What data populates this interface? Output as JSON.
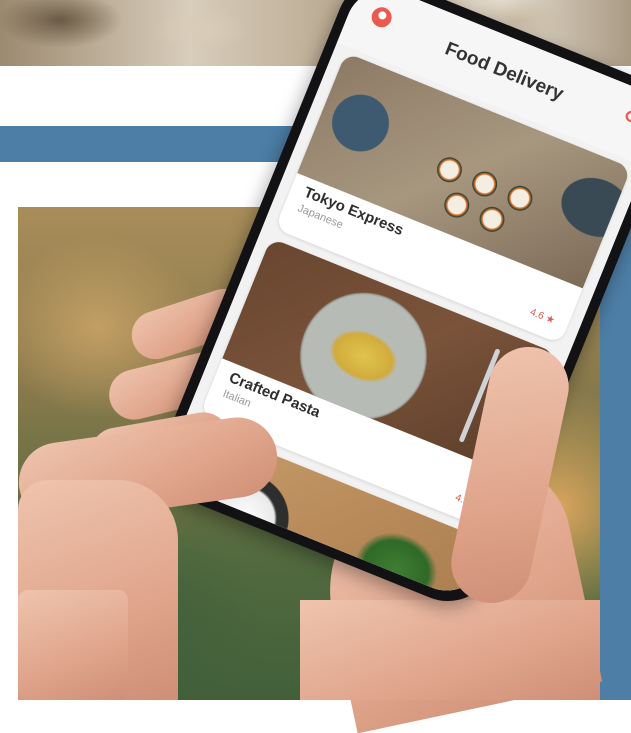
{
  "app": {
    "title": "Food Delivery"
  },
  "header": {
    "left_icon": "profile-icon",
    "right_icon": "search-icon",
    "accent_color": "#ea5a4f"
  },
  "restaurants": [
    {
      "name": "Tokyo Express",
      "cuisine": "Japanese",
      "rating": "4.6 ★"
    },
    {
      "name": "Crafted Pasta",
      "cuisine": "Italian",
      "rating": "4.3 ★"
    }
  ],
  "colors": {
    "frame_blue": "#4d7ea6",
    "rating_red": "#e0574c"
  }
}
